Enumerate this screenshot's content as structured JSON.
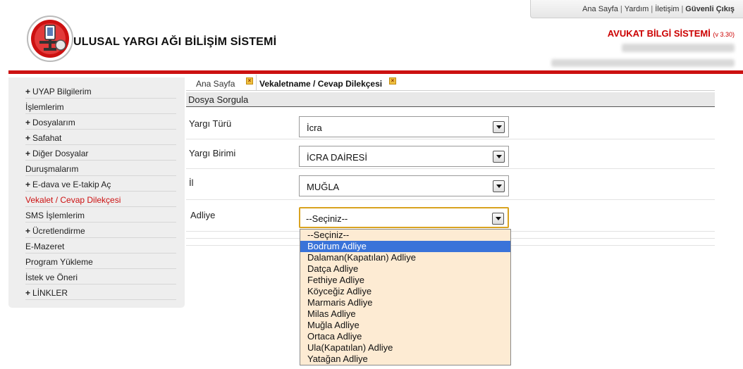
{
  "top_links": {
    "home": "Ana Sayfa",
    "help": "Yardım",
    "contact": "İletişim",
    "logout": "Güvenli Çıkış",
    "separator": "|"
  },
  "header": {
    "site_title": "ULUSAL YARGI AĞI BİLİŞİM SİSTEMİ",
    "app_title": "AVUKAT BİLGİ SİSTEMİ",
    "version": "(v 3.30)"
  },
  "colors": {
    "accent_red": "#cc1111",
    "highlight_blue": "#3a73d9",
    "dropdown_bg": "#fdebd3"
  },
  "sidebar": {
    "items": [
      {
        "label": "UYAP Bilgilerim",
        "expandable": true
      },
      {
        "label": "İşlemlerim",
        "expandable": false
      },
      {
        "label": "Dosyalarım",
        "expandable": true
      },
      {
        "label": "Safahat",
        "expandable": true
      },
      {
        "label": "Diğer Dosyalar",
        "expandable": true
      },
      {
        "label": "Duruşmalarım",
        "expandable": false
      },
      {
        "label": "E-dava ve E-takip Aç",
        "expandable": true
      },
      {
        "label": "Vekalet / Cevap Dilekçesi",
        "expandable": false,
        "active": true
      },
      {
        "label": "SMS İşlemlerim",
        "expandable": false
      },
      {
        "label": "Ücretlendirme",
        "expandable": true
      },
      {
        "label": "E-Mazeret",
        "expandable": false
      },
      {
        "label": "Program Yükleme",
        "expandable": false
      },
      {
        "label": "İstek ve Öneri",
        "expandable": false
      },
      {
        "label": "LİNKLER",
        "expandable": true
      }
    ],
    "plus_symbol": "+"
  },
  "tabs": [
    {
      "label": "Ana Sayfa",
      "close_icon": "close-icon"
    },
    {
      "label": "Vekaletname / Cevap Dilekçesi",
      "close_icon": "close-icon"
    }
  ],
  "section": {
    "title": "Dosya Sorgula"
  },
  "form": {
    "yargi_turu": {
      "label": "Yargı Türü",
      "value": "İcra"
    },
    "yargi_birimi": {
      "label": "Yargı Birimi",
      "value": "İCRA DAİRESİ"
    },
    "il": {
      "label": "İl",
      "value": "MUĞLA"
    },
    "adliye": {
      "label": "Adliye",
      "value": "--Seçiniz--"
    }
  },
  "adliye_options": [
    "--Seçiniz--",
    "Bodrum Adliye",
    "Dalaman(Kapatılan) Adliye",
    "Datça Adliye",
    "Fethiye Adliye",
    "Köyceğiz Adliye",
    "Marmaris Adliye",
    "Milas Adliye",
    "Muğla Adliye",
    "Ortaca Adliye",
    "Ula(Kapatılan) Adliye",
    "Yatağan Adliye"
  ],
  "adliye_highlighted": "Bodrum Adliye"
}
